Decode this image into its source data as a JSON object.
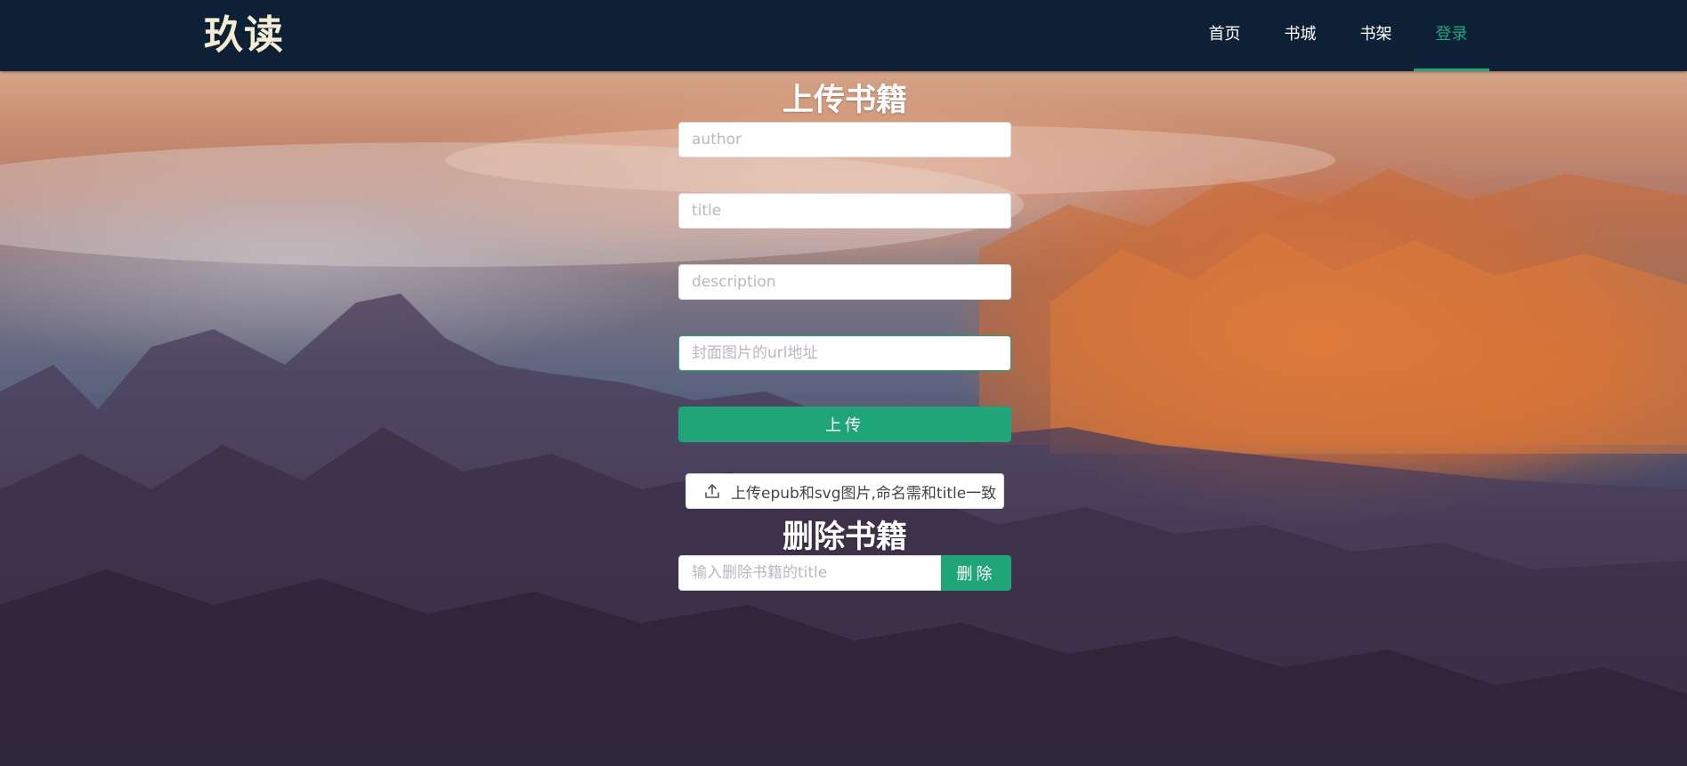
{
  "header": {
    "logo": "玖读",
    "nav": [
      {
        "label": "首页",
        "active": false
      },
      {
        "label": "书城",
        "active": false
      },
      {
        "label": "书架",
        "active": false
      },
      {
        "label": "登录",
        "active": true
      }
    ]
  },
  "upload": {
    "title": "上传书籍",
    "author_placeholder": "author",
    "title_placeholder": "title",
    "description_placeholder": "description",
    "cover_placeholder": "封面图片的url地址",
    "submit_label": "上传",
    "file_button_label": "上传epub和svg图片,命名需和title一致",
    "file_icon": "upload-icon"
  },
  "delete": {
    "title": "删除书籍",
    "input_placeholder": "输入删除书籍的title",
    "button_label": "删除"
  },
  "colors": {
    "header_bg": "#0d2035",
    "accent": "#1fa577",
    "logo": "#f4ecd2"
  }
}
